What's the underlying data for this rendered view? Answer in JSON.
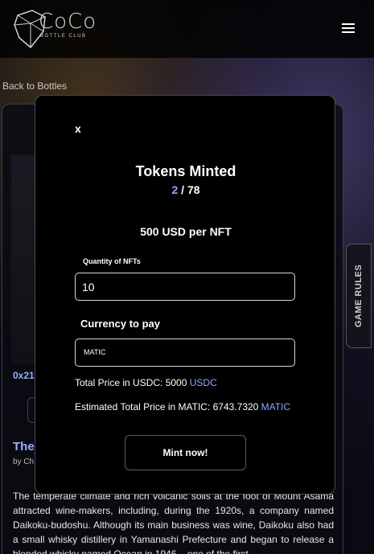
{
  "header": {
    "logo_text": "CoCo",
    "logo_subtext": "BOTTLE CLUB"
  },
  "page": {
    "back_link": "Back to Bottles",
    "address_prefix": "0x21",
    "bottle_title_prefix": "The",
    "by_prefix": "by Ch",
    "description": "The temperate climate and rich volcanic soils at the foot of Mount Asama attracted wine-makers, including, during the 1920s, a company named Daikoku-budoshu. Although its main business was wine, Daikoku also had a small whisky distillery in Yamanashi Prefecture and began to release a blended whisky named Ocean in 1946 – one of the first"
  },
  "side_tab": {
    "label": "GAME RULES"
  },
  "modal": {
    "close_label": "x",
    "title": "Tokens Minted",
    "minted": "2",
    "separator": " / ",
    "total": "78",
    "price": "500 USD per NFT",
    "quantity_label": "Quantity of NFTs",
    "quantity_value": "10",
    "currency_label": "Currency to pay",
    "currency_selected": "MATIC",
    "total_usdc_text": "Total Price in USDC: 5000 ",
    "total_usdc_currency": "USDC",
    "total_matic_text": "Estimated Total Price in MATIC: 6743.7320 ",
    "total_matic_currency": "MATIC",
    "mint_button": "Mint now!"
  },
  "colors": {
    "accent": "#8ea6ff",
    "button_border": "#3f6e62"
  }
}
